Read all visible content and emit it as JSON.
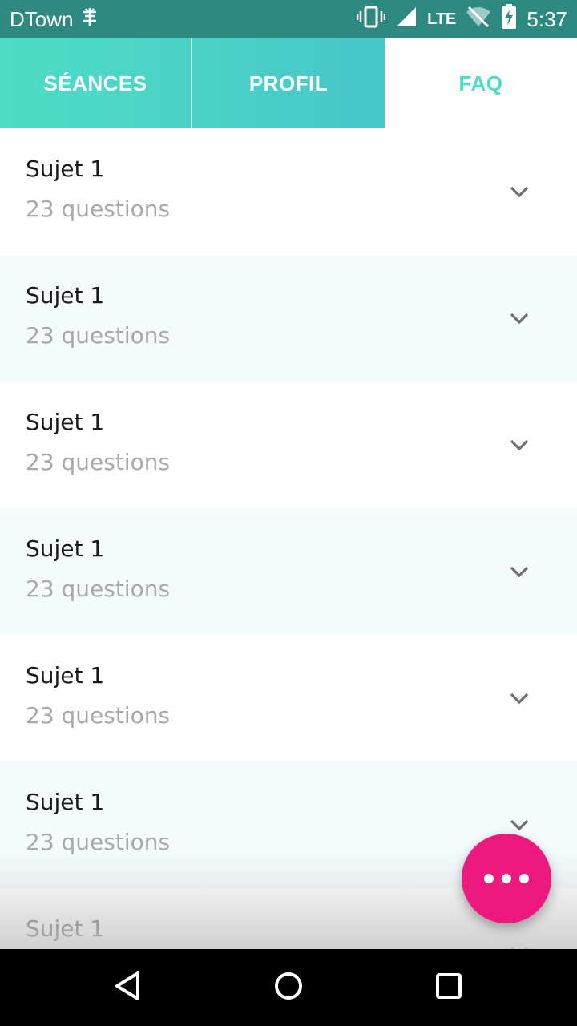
{
  "status_bar": {
    "carrier": "DTown",
    "network": "LTE",
    "time": "5:37",
    "icons": [
      "notification-icon",
      "vibrate-icon",
      "signal-icon",
      "wifi-off-icon",
      "battery-charging-icon"
    ]
  },
  "tabs": [
    {
      "label": "SÉANCES",
      "selected": false
    },
    {
      "label": "PROFIL",
      "selected": false
    },
    {
      "label": "FAQ",
      "selected": true
    }
  ],
  "colors": {
    "status_bar": "#2e8a80",
    "tab_accent": "#4ddcc6",
    "fab": "#ec1a7e",
    "alt_row": "#f5fbfc"
  },
  "faq_items": [
    {
      "title": "Sujet 1",
      "subtitle": "23 questions"
    },
    {
      "title": "Sujet 1",
      "subtitle": "23 questions"
    },
    {
      "title": "Sujet 1",
      "subtitle": "23 questions"
    },
    {
      "title": "Sujet 1",
      "subtitle": "23 questions"
    },
    {
      "title": "Sujet 1",
      "subtitle": "23 questions"
    },
    {
      "title": "Sujet 1",
      "subtitle": "23 questions"
    },
    {
      "title": "Sujet 1",
      "subtitle": ""
    }
  ],
  "fab": {
    "icon": "more-horizontal-icon"
  },
  "nav_bar": {
    "icons": [
      "back-icon",
      "home-icon",
      "recents-icon"
    ]
  }
}
